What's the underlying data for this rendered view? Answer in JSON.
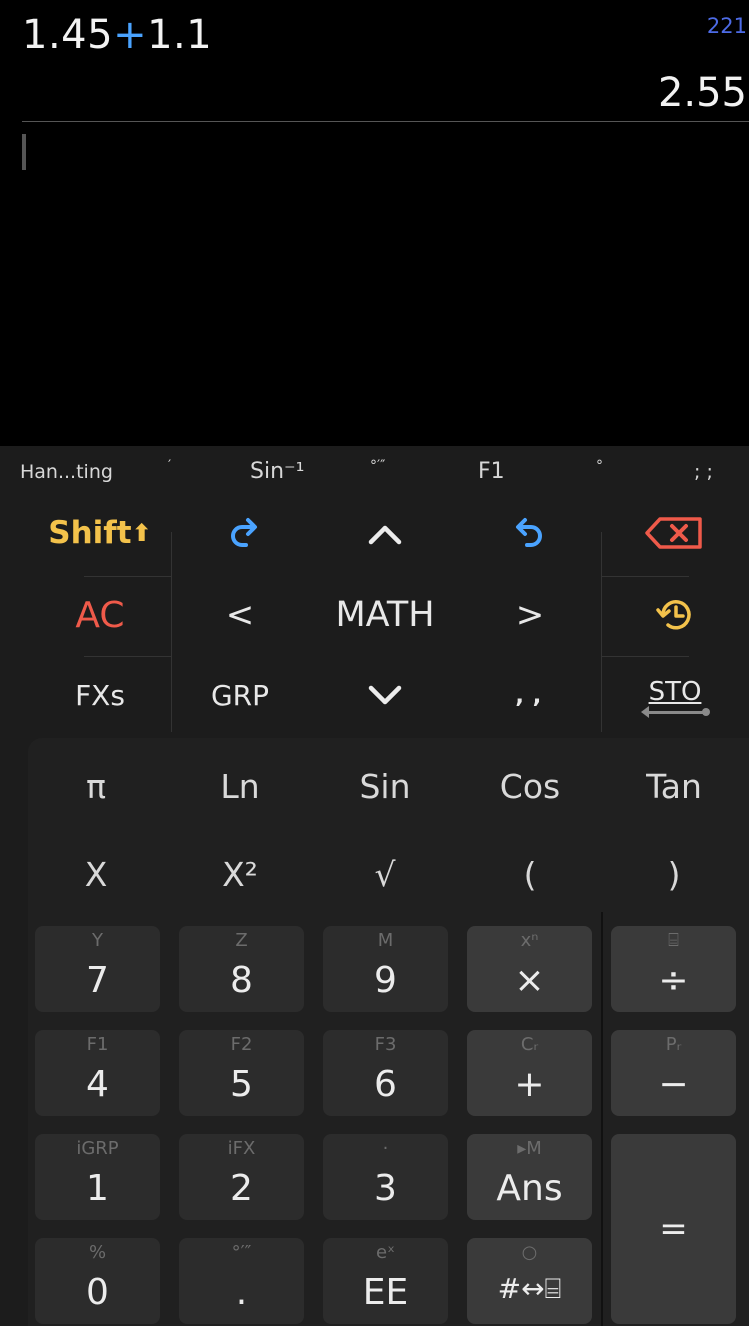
{
  "display": {
    "expression_left": "1.45",
    "expression_op": "+",
    "expression_right": "1.1",
    "counter": "221",
    "result": "2.55"
  },
  "suggestions": [
    "Han...ting",
    "′",
    "Sin⁻¹",
    "°′″",
    "F1",
    "°",
    "; ;"
  ],
  "nav": {
    "shift": "Shift",
    "shift_arrow": "⬆",
    "ac": "AC",
    "fxs": "FXs",
    "grp": "GRP",
    "math": "MATH",
    "left": "<",
    "right": ">",
    "comma": "‚ ‚",
    "sto": "STO"
  },
  "functions": {
    "row1": [
      "π",
      "Ln",
      "Sin",
      "Cos",
      "Tan"
    ],
    "row2": [
      "X",
      "X²",
      "√",
      "(",
      ")"
    ]
  },
  "keys": {
    "row1": [
      {
        "sec": "Y",
        "pri": "7"
      },
      {
        "sec": "Z",
        "pri": "8"
      },
      {
        "sec": "M",
        "pri": "9"
      },
      {
        "sec": "xⁿ",
        "pri": "×"
      },
      {
        "sec": "⌸",
        "pri": "÷"
      }
    ],
    "row2": [
      {
        "sec": "F1",
        "pri": "4"
      },
      {
        "sec": "F2",
        "pri": "5"
      },
      {
        "sec": "F3",
        "pri": "6"
      },
      {
        "sec": "Cᵣ",
        "pri": "+"
      },
      {
        "sec": "Pᵣ",
        "pri": "−"
      }
    ],
    "row3": [
      {
        "sec": "iGRP",
        "pri": "1"
      },
      {
        "sec": "iFX",
        "pri": "2"
      },
      {
        "sec": "·",
        "pri": "3"
      },
      {
        "sec": "▸M",
        "pri": "Ans"
      }
    ],
    "row4": [
      {
        "sec": "%",
        "pri": "0"
      },
      {
        "sec": "°′″",
        "pri": "."
      },
      {
        "sec": "eˣ",
        "pri": "EE"
      },
      {
        "sec": "○",
        "pri": "#↔⌸"
      }
    ],
    "equals": "="
  },
  "colors": {
    "operator": "#4aa3ff",
    "shift": "#f3c24b",
    "ac": "#ef5a4a",
    "delete": "#ef5a4a",
    "redo_undo": "#4aa3ff",
    "history": "#f3c24b",
    "counter": "#4d6be6"
  },
  "icons": {
    "redo": "redo-icon",
    "undo": "undo-icon",
    "up": "chevron-up-icon",
    "down": "chevron-down-icon",
    "delete": "backspace-icon",
    "history": "history-icon"
  }
}
